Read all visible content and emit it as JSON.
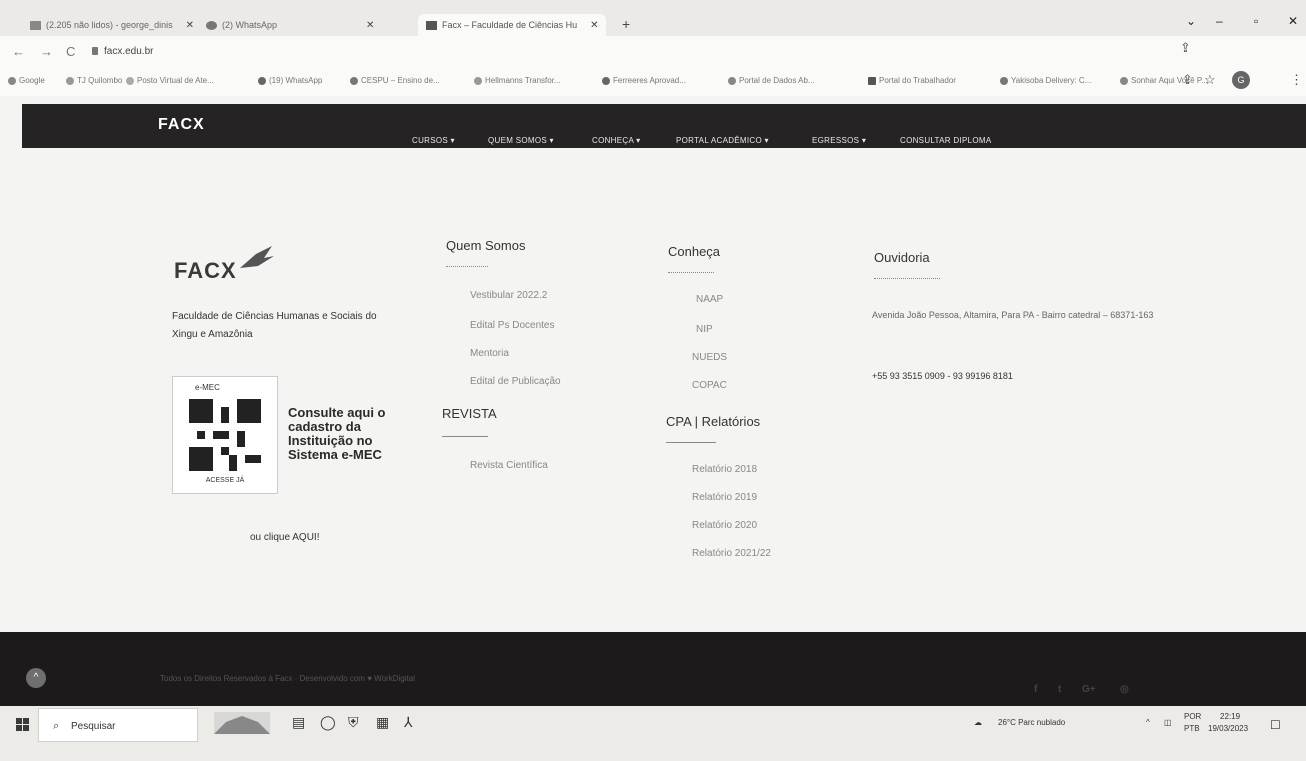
{
  "browser": {
    "tabs": [
      {
        "label": "(2.205 não lidos) - george_dinis",
        "active": false
      },
      {
        "label": "(2) WhatsApp",
        "active": false
      },
      {
        "label": "Facx – Faculdade de Ciências Hu",
        "active": true
      }
    ],
    "url": "facx.edu.br",
    "bookmarks": [
      "Google",
      "TJ Quilombo",
      "Posto Virtual de Ate...",
      "(19) WhatsApp",
      "CESPU – Ensino de...",
      "Hellmanns Transfor...",
      "Ferreeres Aprovad...",
      "Portal de Dados Ab...",
      "Portal do Trabalhador",
      "Yakisoba Delivery: C...",
      "Sonhar Aqui Você P..."
    ],
    "profile_initial": "G"
  },
  "site": {
    "brand": "FACX",
    "menu": [
      "CURSOS ▾",
      "QUEM SOMOS ▾",
      "CONHEÇA ▾",
      "PORTAL ACADÊMICO ▾",
      "EGRESSOS ▾",
      "CONSULTAR DIPLOMA"
    ]
  },
  "footer": {
    "logo": "FACX",
    "tagline": "Faculdade de Ciências Humanas e Sociais do Xingu e Amazônia",
    "emec": {
      "badge": "e-MEC",
      "badge_footer": "ACESSE JÁ",
      "text": "Consulte aqui o cadastro da Instituição no Sistema e-MEC",
      "cta": "ou clique AQUI!"
    },
    "quem_somos": {
      "title": "Quem Somos",
      "links": [
        "Vestibular 2022.2",
        "Edital Ps Docentes",
        "Mentoria",
        "Edital de Publicação"
      ]
    },
    "revista": {
      "title": "REVISTA",
      "links": [
        "Revista Científica"
      ]
    },
    "conheca": {
      "title": "Conheça",
      "links": [
        "NAAP",
        "NIP",
        "NUEDS",
        "COPAC"
      ]
    },
    "cpa": {
      "title": "CPA | Relatórios",
      "links": [
        "Relatório 2018",
        "Relatório 2019",
        "Relatório 2020",
        "Relatório 2021/22"
      ]
    },
    "ouvidoria": {
      "title": "Ouvidoria",
      "address": "Avenida João Pessoa, Altamira, Para PA - Bairro catedral – 68371-163",
      "phone": "+55 93 3515 0909 - 93 99196 8181"
    },
    "copyright": "Todos os Direitos Reservados à Facx · Desenvolvido com ♥ WorkDigital"
  },
  "taskbar": {
    "search_placeholder": "Pesquisar",
    "weather": "26°C  Parc nublado",
    "lang": "POR",
    "lang2": "PTB",
    "time": "22:19",
    "date": "19/03/2023"
  },
  "colors": {
    "header_bg": "#252323",
    "page_bg": "#f4f4f2",
    "footer_bottom_bg": "#1c1a1a"
  }
}
